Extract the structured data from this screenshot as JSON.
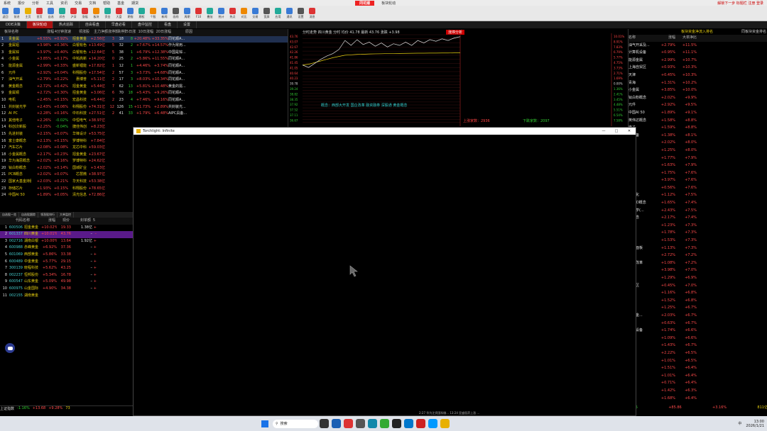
{
  "app": {
    "title": "同花顺",
    "subtitle": "板块轮动",
    "top_right": "解锁下一步 标题栏 注册 登录"
  },
  "menu": [
    "系统",
    "报价",
    "分析",
    "工具",
    "资讯",
    "交易",
    "文档",
    "帮助",
    "基金",
    "期货"
  ],
  "toolbar": [
    "返回",
    "前进",
    "主页",
    "首页",
    "自选",
    "综合",
    "沪深",
    "涨幅",
    "板块",
    "资金",
    "大盘",
    "期指",
    "期权",
    "个股",
    "新闻",
    "画线",
    "周期",
    "F10",
    "叠加",
    "统计",
    "热点",
    "对比",
    "交易",
    "宽屏",
    "应用",
    "通讯",
    "设置",
    "消息"
  ],
  "tabs": [
    "DDE决策",
    "板块轮动",
    "热点追踪",
    "自由看盘",
    "早盘必看",
    "盘中监控",
    "看盘",
    "设置"
  ],
  "sector_table": {
    "headers": [
      "板块名称",
      "涨幅",
      "4分钟涨速",
      "领涨股",
      "主力净额",
      "涨停数",
      "跌停数",
      "5日涨幅",
      "10日涨幅",
      "20日涨幅",
      "原因"
    ],
    "rows": [
      [
        "1",
        "贵金属",
        "+6.55%",
        "+0.92%",
        "招金黄金",
        "+2.56亿",
        "3",
        "18",
        "8",
        "+20.48%",
        "+33.35%",
        "同花顺A..."
      ],
      [
        "2",
        "金属铝",
        "+3.98%",
        "+0.36%",
        "白银有色",
        "+13.49亿",
        "5",
        "32",
        "2",
        "+7.67%",
        "+14.57%",
        "作为常用..."
      ],
      [
        "3",
        "金属锌",
        "+3.97%",
        "+0.40%",
        "白银有色",
        "+12.64亿",
        "5",
        "38",
        "1",
        "+6.79%",
        "+12.38%",
        "中国是锌..."
      ],
      [
        "4",
        "小金属",
        "+3.85%",
        "+0.17%",
        "中钨高新",
        "+14.20亿",
        "0",
        "25",
        "2",
        "+5.86%",
        "+11.55%",
        "同花顺A..."
      ],
      [
        "5",
        "能源金属",
        "+2.99%",
        "+0.33%",
        "盛新锂能",
        "+17.82亿",
        "1",
        "12",
        "1",
        "+4.46%",
        "+3.74%",
        "同花顺A..."
      ],
      [
        "6",
        "元件",
        "+2.92%",
        "+0.04%",
        "科翔股份",
        "+17.54亿",
        "2",
        "57",
        "3",
        "+3.73%",
        "+4.68%",
        "同花顺A..."
      ],
      [
        "7",
        "油气开采",
        "+2.79%",
        "+0.22%",
        "惠博普",
        "+5.11亿",
        "2",
        "17",
        "3",
        "+8.03%",
        "+10.34%",
        "同花顺A..."
      ],
      [
        "8",
        "黄金概念",
        "+2.72%",
        "+0.42%",
        "招金黄金",
        "+5.44亿",
        "7",
        "62",
        "13",
        "+5.81%",
        "+10.48%",
        "黄金的需..."
      ],
      [
        "9",
        "金属铜",
        "+2.72%",
        "+0.30%",
        "招金黄金",
        "+3.06亿",
        "6",
        "70",
        "18",
        "+5.43%",
        "+9.26%",
        "同花顺A..."
      ],
      [
        "10",
        "电机",
        "+2.45%",
        "+0.15%",
        "宏昌科技",
        "+6.44亿",
        "2",
        "23",
        "4",
        "+7.46%",
        "+9.16%",
        "同花顺A..."
      ],
      [
        "11",
        "共封装光学",
        "+2.43%",
        "+0.06%",
        "科翔股份",
        "+74.31亿",
        "12",
        "126",
        "15",
        "+11.73%",
        "+2.89%",
        "共封装光..."
      ],
      [
        "12",
        "AI PC",
        "+2.28%",
        "+0.16%",
        "中石科技",
        "+27.51亿",
        "2",
        "41",
        "33",
        "+1.79%",
        "+6.48%",
        "AIPC具备..."
      ],
      [
        "13",
        "其他电子",
        "+2.26%",
        "-0.02%",
        "中恒电气",
        "+38.97亿",
        "",
        "",
        "",
        "",
        "",
        ""
      ],
      [
        "14",
        "科创次新股",
        "+2.25%",
        "-0.04%",
        "捷佳伟创",
        "+8.23亿",
        "",
        "",
        "",
        "",
        "",
        ""
      ],
      [
        "15",
        "先进封装",
        "+2.15%",
        "+0.07%",
        "华锋设计",
        "+53.75亿",
        "",
        "",
        "",
        "",
        "",
        ""
      ],
      [
        "16",
        "富士康概念",
        "+2.13%",
        "+0.15%",
        "罗博特科",
        "+7.84亿",
        "",
        "",
        "",
        "",
        "",
        ""
      ],
      [
        "17",
        "汽车芯片",
        "+2.08%",
        "+0.08%",
        "龙芯中科",
        "+59.03亿",
        "",
        "",
        "",
        "",
        "",
        ""
      ],
      [
        "18",
        "小金属概念",
        "+2.17%",
        "+0.23%",
        "招金黄金",
        "+23.67亿",
        "",
        "",
        "",
        "",
        "",
        ""
      ],
      [
        "19",
        "华为海思概念",
        "+2.02%",
        "+0.16%",
        "罗博特科",
        "+24.62亿",
        "",
        "",
        "",
        "",
        "",
        ""
      ],
      [
        "20",
        "钛白粉概念",
        "+2.02%",
        "+0.14%",
        "国城矿业",
        "+3.43亿",
        "",
        "",
        "",
        "",
        "",
        ""
      ],
      [
        "21",
        "PCB概念",
        "+2.02%",
        "+0.07%",
        "芯慧微",
        "+38.97亿",
        "",
        "",
        "",
        "",
        "",
        ""
      ],
      [
        "22",
        "国家大基金持股",
        "+2.03%",
        "+0.21%",
        "华天科技",
        "+53.38亿",
        "",
        "",
        "",
        "",
        "",
        ""
      ],
      [
        "23",
        "存储芯片",
        "+1.93%",
        "+0.15%",
        "科翔股份",
        "+78.65亿",
        "",
        "",
        "",
        "",
        "",
        ""
      ],
      [
        "24",
        "中国AI 50",
        "+1.89%",
        "+0.05%",
        "清光信息",
        "+72.86亿",
        "",
        "",
        "",
        "",
        "",
        ""
      ]
    ]
  },
  "stock_tabs": [
    "自选股一览",
    "自选股跟踪",
    "领涨股排行",
    "大单监控"
  ],
  "stock_table": {
    "headers": [
      "代码",
      "名称",
      "涨幅",
      "现价",
      "封单额",
      "5"
    ],
    "rows": [
      [
        "1",
        "600506",
        "招金黄金",
        "+10.02%",
        "19.33",
        "1.38亿",
        "+"
      ],
      [
        "2",
        "601337",
        "四川黄金",
        "+10.01%",
        "43.76",
        "–",
        "–"
      ],
      [
        "3",
        "002716",
        "湖南白银",
        "+10.00%",
        "13.64",
        "1.92亿",
        "+"
      ],
      [
        "4",
        "600988",
        "赤峰黄金",
        "+6.92%",
        "37.36",
        "–",
        "+"
      ],
      [
        "5",
        "601069",
        "西部黄金",
        "+5.86%",
        "33.38",
        "–",
        "+"
      ],
      [
        "6",
        "600489",
        "中金黄金",
        "+5.77%",
        "29.15",
        "–",
        "+"
      ],
      [
        "7",
        "300139",
        "晓程科技",
        "+5.62%",
        "43.25",
        "–",
        "+"
      ],
      [
        "8",
        "002237",
        "恒邦股份",
        "+5.34%",
        "16.78",
        "–",
        "+"
      ],
      [
        "9",
        "600547",
        "山东黄金",
        "+5.09%",
        "49.98",
        "–",
        "+"
      ],
      [
        "10",
        "600975",
        "山金国际",
        "+4.90%",
        "34.38",
        "–",
        "+"
      ],
      [
        "11",
        "002155",
        "湖南黄金",
        "",
        "",
        "",
        ""
      ]
    ]
  },
  "chart": {
    "header": "分时走势  四川黄金  分时  均价 41.78  最新 43.76  涨跌 +3.98",
    "tag": "涨停分析",
    "price_labels": [
      "43.76",
      "43.07",
      "42.67",
      "42.26",
      "41.86",
      "41.45",
      "41.05",
      "40.64",
      "40.23",
      "39.78",
      "39.24",
      "38.82",
      "38.35",
      "37.92",
      "37.52",
      "37.11",
      "36.67"
    ],
    "pct_labels": [
      "10.01%",
      "8.91%",
      "7.83%",
      "6.79%",
      "5.77%",
      "4.75%",
      "3.73%",
      "2.71%",
      "1.69%",
      "0.00%",
      "1.36%",
      "2.41%",
      "3.45%",
      "4.48%",
      "5.51%",
      "6.54%",
      "7.58%"
    ],
    "concept_note": "概念：西部大开发  国企改革  融资融券  深股通  黄金概念",
    "up_count": "上涨家数：2936",
    "down_count": "下跌家数：2097",
    "series_price": [
      40.3,
      40.0,
      40.5,
      41.0,
      41.4,
      41.7,
      42.2,
      43.3,
      42.7,
      43.4,
      42.8,
      43.1,
      42.6,
      43.0,
      42.5,
      42.9,
      42.7,
      43.1,
      42.7,
      43.3,
      43.0,
      43.4,
      43.2,
      43.5,
      43.3,
      43.6,
      43.76
    ],
    "series_avg": [
      40.3,
      40.4,
      40.6,
      40.8,
      41.0,
      41.2,
      41.35,
      41.5,
      41.55,
      41.6,
      41.62,
      41.65,
      41.67,
      41.68,
      41.7,
      41.71,
      41.72,
      41.73,
      41.74,
      41.75,
      41.75,
      41.76,
      41.76,
      41.77,
      41.77,
      41.78,
      41.78
    ],
    "ymin": 36.67,
    "ymax": 43.76
  },
  "right_panel": {
    "title": "板块资金净流入排名",
    "sub_tabs": "同板块资金排名",
    "headers": [
      "名称",
      "涨幅",
      "大单净比"
    ],
    "rows": [
      [
        "油气开采及...",
        "+2.79%",
        "+11.5%"
      ],
      [
        "计算机设备",
        "+0.95%",
        "+11.1%"
      ],
      [
        "能源金属",
        "+2.99%",
        "+10.7%"
      ],
      [
        "上海自贸区",
        "+0.93%",
        "+10.3%"
      ],
      [
        "天津",
        "+0.45%",
        "+10.3%"
      ],
      [
        "青海",
        "+1.31%",
        "+10.2%"
      ],
      [
        "小金属",
        "+3.85%",
        "+10.0%"
      ],
      [
        "钛白粉概念",
        "+2.02%",
        "+9.9%"
      ],
      [
        "元件",
        "+2.92%",
        "+9.5%"
      ],
      [
        "中国AI 50",
        "+1.89%",
        "+9.1%"
      ],
      [
        "英伟达概念",
        "+1.58%",
        "+8.8%"
      ],
      [
        "电子",
        "+1.59%",
        "+8.8%"
      ],
      [
        "化设备",
        "+1.38%",
        "+8.1%"
      ],
      [
        "概念",
        "+2.02%",
        "+8.0%"
      ],
      [
        "",
        "+1.25%",
        "+8.0%"
      ],
      [
        "推理",
        "+1.77%",
        "+7.9%"
      ],
      [
        "电容",
        "+1.63%",
        "+7.9%"
      ],
      [
        "回收",
        "+1.75%",
        "+7.6%"
      ],
      [
        "评",
        "+3.97%",
        "+7.6%"
      ],
      [
        "",
        "+0.56%",
        "+7.6%"
      ],
      [
        "工业化",
        "+1.12%",
        "+7.5%"
      ],
      [
        "roLED概念",
        "+1.65%",
        "+7.4%"
      ],
      [
        "装光学(...",
        "+2.43%",
        "+7.5%"
      ],
      [
        "属概念",
        "+2.17%",
        "+7.4%"
      ],
      [
        "概念",
        "+1.23%",
        "+7.3%"
      ],
      [
        "LED",
        "+1.78%",
        "+7.3%"
      ],
      [
        "水砌",
        "+1.53%",
        "+7.3%"
      ],
      [
        "电路面板",
        "+1.13%",
        "+7.3%"
      ],
      [
        "",
        "+2.72%",
        "+7.2%"
      ],
      [
        "国企改革",
        "+1.08%",
        "+7.2%"
      ],
      [
        "铝",
        "+3.98%",
        "+7.0%"
      ],
      [
        "电池",
        "+1.29%",
        "+6.9%"
      ],
      [
        "自贸区",
        "+0.45%",
        "+7.0%"
      ],
      [
        "车",
        "+1.16%",
        "+6.8%"
      ],
      [
        "手机",
        "+1.52%",
        "+6.8%"
      ],
      [
        "器",
        "+1.25%",
        "+6.7%"
      ],
      [
        "大基金...",
        "+2.03%",
        "+6.7%"
      ],
      [
        "",
        "+0.63%",
        "+6.7%"
      ],
      [
        "电源设备",
        "+1.74%",
        "+6.6%"
      ],
      [
        "概念",
        "+1.09%",
        "+6.6%"
      ],
      [
        "家电",
        "+1.43%",
        "+6.7%"
      ],
      [
        "仪",
        "+2.22%",
        "+6.5%"
      ],
      [
        "链",
        "+1.01%",
        "+6.5%"
      ],
      [
        "概念",
        "+1.51%",
        "+6.4%"
      ],
      [
        "古",
        "+1.01%",
        "+6.4%"
      ],
      [
        "科技",
        "+0.71%",
        "+6.4%"
      ],
      [
        "",
        "+1.42%",
        "+6.3%"
      ],
      [
        "务器",
        "+1.68%",
        "+6.4%"
      ]
    ],
    "footer": [
      "-9.85",
      "+85.86",
      "+3.16%",
      "811亿"
    ]
  },
  "overlay": {
    "title": "Torchlight: Infinite"
  },
  "bottom_status": {
    "left": "上证指数",
    "mid_values": [
      "-1.16%",
      "+13.68",
      "+9.28%",
      "73"
    ],
    "news1": "2:27 华为注资国科微... 13:24 亚盛医药上涨  ...",
    "news2": "2:52 中科创达获下游市场... 13:23 北京华讯 ...",
    "right_links": "资讯 提醒 机器 短线精灵"
  },
  "taskbar": {
    "search_placeholder": "搜索",
    "time": "13:00",
    "date": "2026/1/21",
    "ime": "中"
  }
}
